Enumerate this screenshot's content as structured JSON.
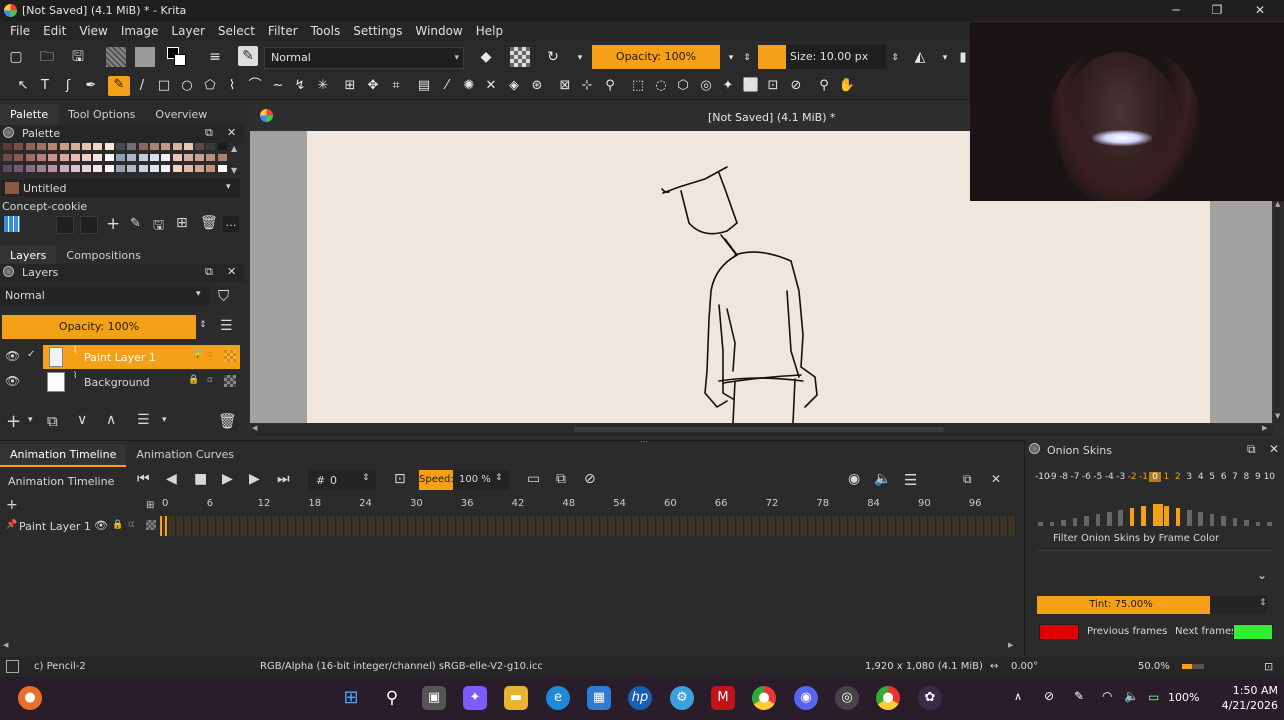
{
  "window": {
    "title": "[Not Saved]  (4.1 MiB) * - Krita",
    "minimize_icon": "─",
    "maximize_icon": "❐",
    "close_icon": "✕"
  },
  "menu": [
    "File",
    "Edit",
    "View",
    "Image",
    "Layer",
    "Select",
    "Filter",
    "Tools",
    "Settings",
    "Window",
    "Help"
  ],
  "toolbar": {
    "blend_mode": "Normal",
    "opacity": "Opacity: 100%",
    "size": "Size: 10.00 px"
  },
  "left_dock": {
    "tabs": [
      "Palette",
      "Tool Options",
      "Overview"
    ],
    "palette_title": "Palette",
    "palette_name": "Untitled",
    "palette_set": "Concept-cookie",
    "layer_tabs": [
      "Layers",
      "Compositions"
    ],
    "layers_title": "Layers",
    "blend_mode": "Normal",
    "opacity": "Opacity:  100%",
    "layers": [
      {
        "name": "Paint Layer 1",
        "selected": true
      },
      {
        "name": "Background",
        "selected": false
      }
    ]
  },
  "canvas": {
    "doc_title": "[Not Saved]  (4.1 MiB) *"
  },
  "timeline": {
    "tabs": [
      "Animation Timeline",
      "Animation Curves"
    ],
    "title": "Animation Timeline",
    "frame_label": "#",
    "frame_value": "0",
    "speed_label": "Speed:",
    "speed_value": "100 %",
    "ruler": [
      "0",
      "6",
      "12",
      "18",
      "24",
      "30",
      "36",
      "42",
      "48",
      "54",
      "60",
      "66",
      "72",
      "78",
      "84",
      "90",
      "96"
    ],
    "layer_name": "Paint Layer 1"
  },
  "onion": {
    "title": "Onion Skins",
    "numbers": [
      "-10",
      "-9",
      "-8",
      "-7",
      "-6",
      "-5",
      "-4",
      "-3",
      "-2",
      "-1",
      "0",
      "1",
      "2",
      "3",
      "4",
      "5",
      "6",
      "7",
      "8",
      "9",
      "10"
    ],
    "active_numbers": [
      "-2",
      "-1",
      "0",
      "1",
      "2"
    ],
    "filter_label": "Filter Onion Skins by Frame Color",
    "tint": "Tint: 75.00%",
    "tint_fraction": 0.75,
    "previous_frames": "Previous frames",
    "next_frames": "Next frames",
    "previous_color": "#e00000",
    "next_color": "#33ee33"
  },
  "status": {
    "tool": "c) Pencil-2",
    "color_space": "RGB/Alpha (16-bit integer/channel)  sRGB-elle-V2-g10.icc",
    "dimensions": "1,920 x 1,080 (4.1 MiB)",
    "rotation": "0.00°",
    "zoom": "50.0%"
  },
  "taskbar": {
    "time": "1:50 AM",
    "date": "4/21/2026",
    "battery": "100%"
  },
  "colors": {
    "accent": "#f4a117",
    "paper": "#efe6dd",
    "panel": "#2b2b2b"
  }
}
